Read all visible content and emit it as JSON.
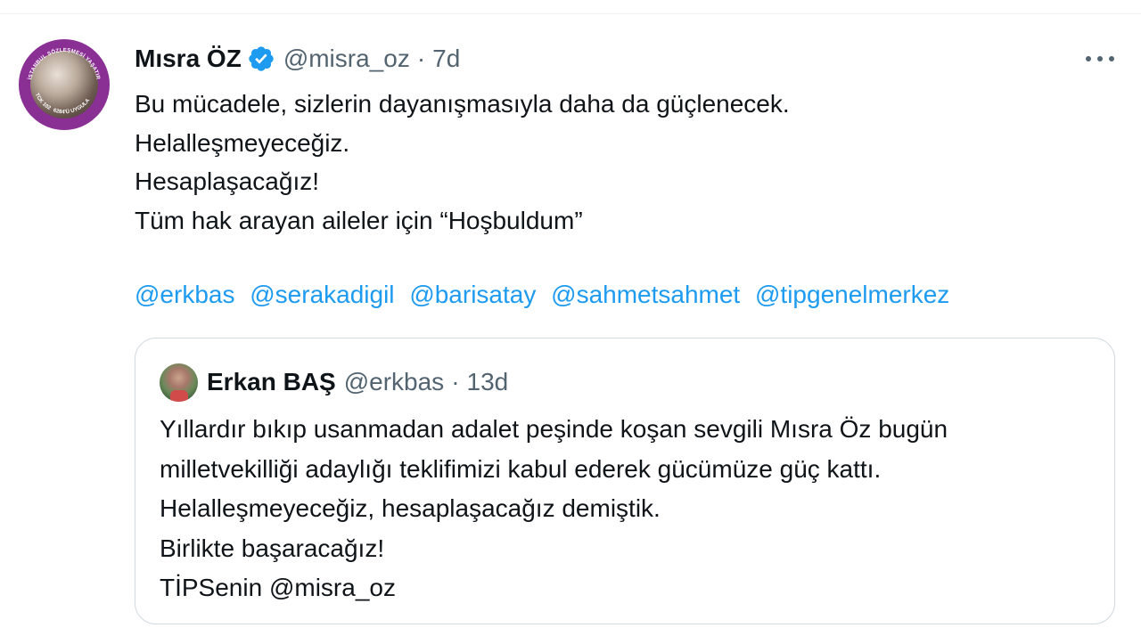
{
  "tweet": {
    "author": {
      "display_name": "Mısra ÖZ",
      "handle": "@misra_oz",
      "verified": true,
      "avatar_ring_text_top": "İSTANBUL SÖZLEŞMESİ YAŞATIR",
      "avatar_ring_text_bottom": "6284'Ü UYGULA",
      "avatar_ring_text_left": "TCK 102"
    },
    "separator": "·",
    "time": "7d",
    "more_icon": "more-horizontal-icon",
    "text_lines": [
      "Bu mücadele, sizlerin dayanışmasıyla daha da güçlenecek.",
      "Helalleşmeyeceğiz.",
      "Hesaplaşacağız!",
      "Tüm hak arayan aileler için “Hoşbuldum”"
    ],
    "mentions": [
      "@erkbas",
      "@serakadigil",
      "@barisatay",
      "@sahmetsahmet",
      "@tipgenelmerkez"
    ]
  },
  "quote": {
    "author": {
      "display_name": "Erkan BAŞ",
      "handle": "@erkbas"
    },
    "separator": "·",
    "time": "13d",
    "text_lines": [
      "Yıllardır bıkıp usanmadan adalet peşinde koşan sevgili Mısra Öz bugün",
      "milletvekilliği adaylığı teklifimizi kabul ederek gücümüze güç kattı.",
      "Helalleşmeyeceğiz, hesaplaşacağız demiştik.",
      "Birlikte başaracağız!"
    ],
    "last_line_prefix": "TİPSenin ",
    "last_line_mention": "@misra_oz"
  },
  "colors": {
    "text_primary": "#0f1419",
    "text_secondary": "#536471",
    "link": "#1d9bf0",
    "border": "#cfd9de",
    "verified_badge": "#1d9bf0",
    "avatar_ring": "#8a2f94"
  }
}
